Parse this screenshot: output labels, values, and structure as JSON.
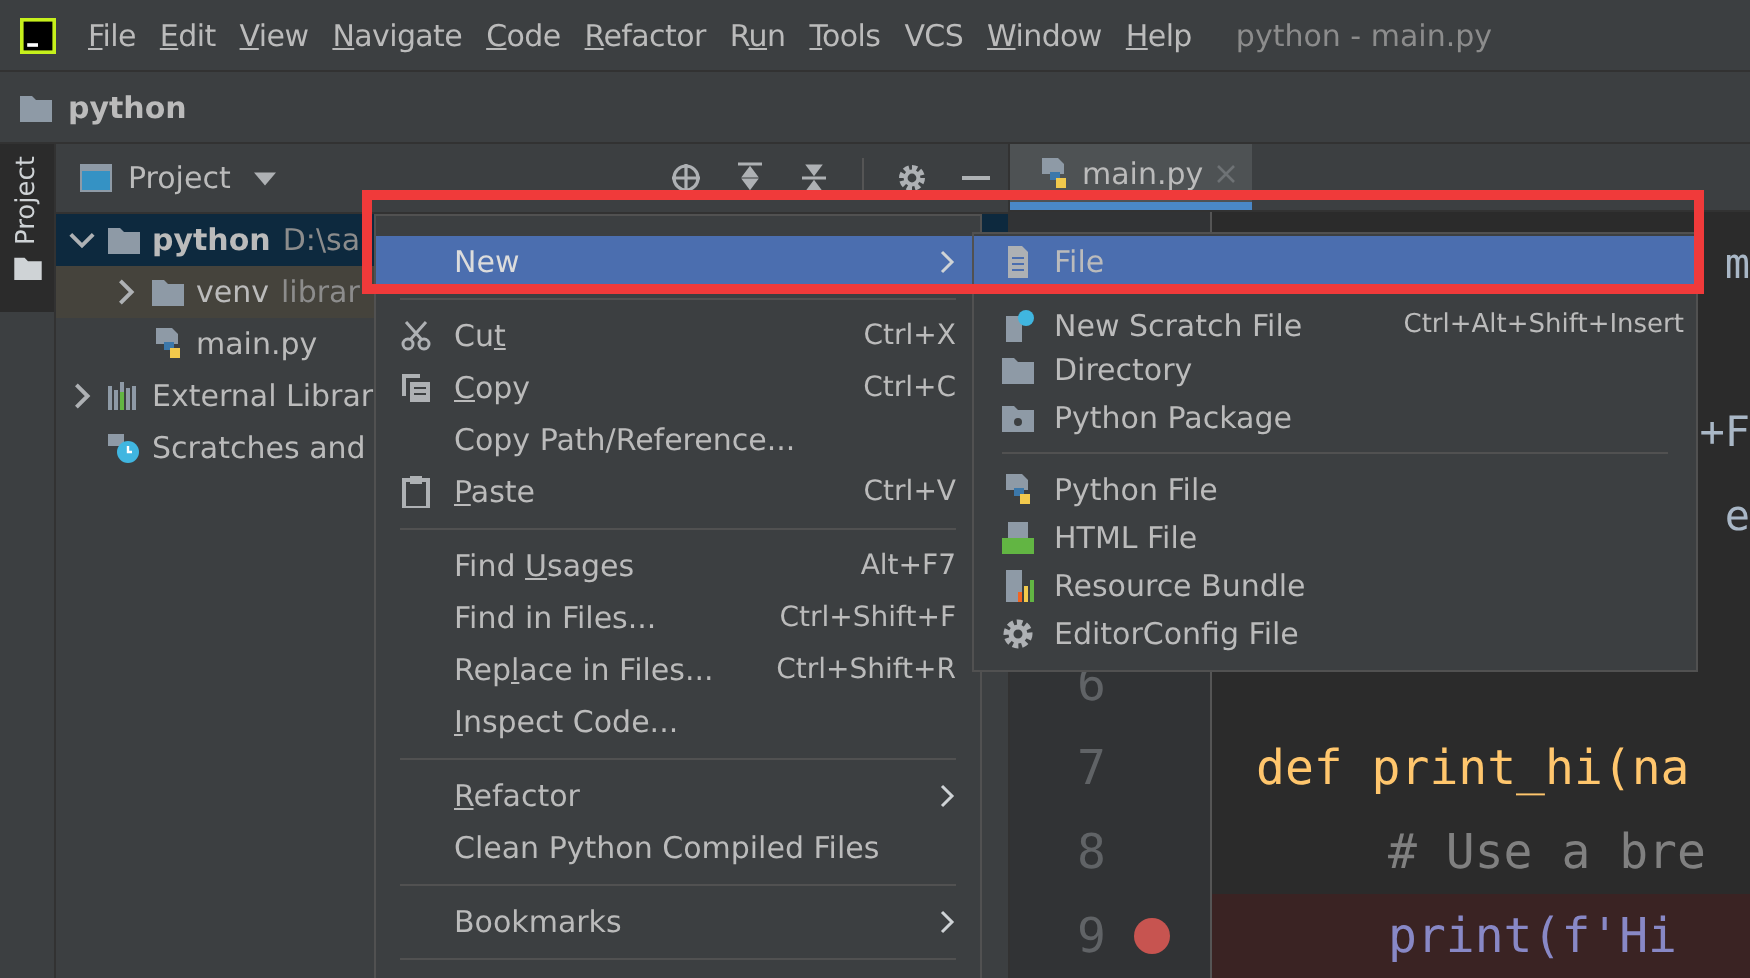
{
  "menu_bar": {
    "items": [
      {
        "key": "F",
        "rest": "ile"
      },
      {
        "key": "E",
        "rest": "dit"
      },
      {
        "key": "V",
        "rest": "iew"
      },
      {
        "key": "N",
        "rest": "avigate"
      },
      {
        "key": "C",
        "rest": "ode"
      },
      {
        "key": "R",
        "rest": "efactor"
      },
      {
        "text": "R",
        "key": "u",
        "rest": "n"
      },
      {
        "key": "T",
        "rest": "ools"
      },
      {
        "text": "VCS"
      },
      {
        "key": "W",
        "rest": "indow"
      },
      {
        "key": "H",
        "rest": "elp"
      }
    ],
    "title": "python - main.py"
  },
  "breadcrumb": {
    "label": "python"
  },
  "side_strip": {
    "tab": {
      "label": "Project",
      "selected": true
    }
  },
  "project_panel": {
    "title": "Project",
    "tree": [
      {
        "kind": "folder",
        "name": "python",
        "detail": "D:\\sa",
        "expanded": true,
        "selected": true,
        "children": [
          {
            "kind": "library-folder",
            "name": "venv",
            "detail": "librar",
            "expanded": false,
            "selected": false
          },
          {
            "kind": "python-file",
            "name": "main.py",
            "selected": false
          }
        ]
      },
      {
        "kind": "library",
        "name": "External Librar",
        "expanded": false,
        "selected": false
      },
      {
        "kind": "scratch",
        "name": "Scratches and",
        "selected": false
      }
    ]
  },
  "editor": {
    "tab": {
      "label": "main.py",
      "selected": true
    },
    "lines": [
      {
        "kind": "fragment",
        "code": "m"
      },
      {
        "kind": "hidden"
      },
      {
        "kind": "fragment",
        "code": "+F"
      },
      {
        "kind": "fragment",
        "code": "e"
      },
      {
        "kind": "hidden"
      },
      {
        "kind": "code",
        "number": "6",
        "breakpoint": false
      },
      {
        "kind": "code",
        "number": "7",
        "code": "def print_hi(na",
        "breakpoint": false
      },
      {
        "kind": "code",
        "number": "8",
        "code": "# Use a bre",
        "breakpoint": false
      },
      {
        "kind": "code",
        "number": "9",
        "code": "print(f'Hi",
        "breakpoint": true
      }
    ]
  },
  "context_menu": {
    "items": [
      {
        "kind": "item",
        "text": "New",
        "submenu": true,
        "selected": true
      },
      {
        "kind": "separator"
      },
      {
        "kind": "item",
        "text": "Cu",
        "key": "t",
        "shortcut": "Ctrl+X",
        "selected": false
      },
      {
        "kind": "item",
        "key": "C",
        "rest": "opy",
        "shortcut": "Ctrl+C",
        "selected": false
      },
      {
        "kind": "item",
        "text": "Copy Path/Reference...",
        "selected": false
      },
      {
        "kind": "item",
        "key": "P",
        "rest": "aste",
        "shortcut": "Ctrl+V",
        "selected": false
      },
      {
        "kind": "separator"
      },
      {
        "kind": "item",
        "text": "Find ",
        "key": "U",
        "rest": "sages",
        "shortcut": "Alt+F7",
        "selected": false
      },
      {
        "kind": "item",
        "text": "Find in Files...",
        "shortcut": "Ctrl+Shift+F",
        "selected": false
      },
      {
        "kind": "item",
        "text": "Rep",
        "key": "l",
        "rest": "ace in Files...",
        "shortcut": "Ctrl+Shift+R",
        "selected": false
      },
      {
        "kind": "item",
        "key": "I",
        "rest": "nspect Code...",
        "selected": false
      },
      {
        "kind": "separator"
      },
      {
        "kind": "item",
        "key": "R",
        "rest": "efactor",
        "submenu": true,
        "selected": false
      },
      {
        "kind": "item",
        "text": "Clean Python Compiled Files",
        "selected": false
      },
      {
        "kind": "separator"
      },
      {
        "kind": "item",
        "text": "Bookmarks",
        "submenu": true,
        "selected": false
      },
      {
        "kind": "separator"
      }
    ]
  },
  "submenu": {
    "items": [
      {
        "kind": "item",
        "label": "File",
        "selected": true
      },
      {
        "kind": "item",
        "label": "New Scratch File",
        "shortcut": "Ctrl+Alt+Shift+Insert",
        "selected": false
      },
      {
        "kind": "item",
        "label": "Directory",
        "selected": false
      },
      {
        "kind": "item",
        "label": "Python Package",
        "selected": false
      },
      {
        "kind": "separator"
      },
      {
        "kind": "item",
        "label": "Python File",
        "selected": false
      },
      {
        "kind": "item",
        "label": "HTML File",
        "selected": false
      },
      {
        "kind": "item",
        "label": "Resource Bundle",
        "selected": false
      },
      {
        "kind": "item",
        "label": "EditorConfig File",
        "selected": false
      }
    ]
  },
  "annotation": {
    "highlight_frame": true
  }
}
